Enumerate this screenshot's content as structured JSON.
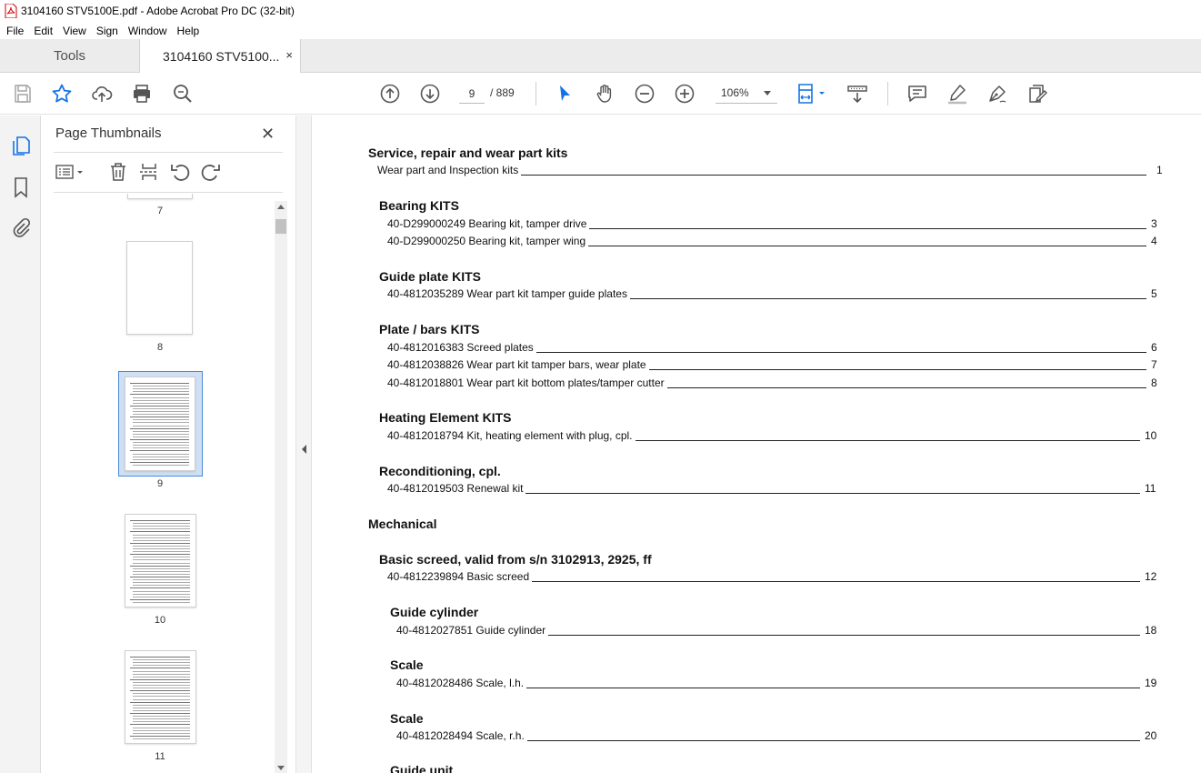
{
  "window": {
    "title": "3104160 STV5100E.pdf - Adobe Acrobat Pro DC (32-bit)"
  },
  "menu": [
    "File",
    "Edit",
    "View",
    "Sign",
    "Window",
    "Help"
  ],
  "tabs": {
    "tools": "Tools",
    "document": "3104160 STV5100...",
    "close": "×"
  },
  "toolbar": {
    "page_current": "9",
    "page_total": "/ 889",
    "zoom": "106%"
  },
  "thumbnails": {
    "title": "Page Thumbnails",
    "close": "✕",
    "pages": [
      {
        "label": "7"
      },
      {
        "label": "8"
      },
      {
        "label": "9",
        "selected": true
      },
      {
        "label": "10"
      },
      {
        "label": "11"
      }
    ]
  },
  "toc": {
    "sections": [
      {
        "heading": "Service, repair and wear part kits"
      },
      {
        "entry": "Wear part and Inspection kits",
        "page": "1"
      },
      {
        "heading": "Bearing KITS"
      },
      {
        "entry": "40-D299000249 Bearing kit, tamper drive",
        "page": "3"
      },
      {
        "entry": "40-D299000250 Bearing kit, tamper wing",
        "page": "4"
      },
      {
        "heading": "Guide plate KITS"
      },
      {
        "entry": "40-4812035289 Wear part kit tamper guide plates",
        "page": "5"
      },
      {
        "heading": "Plate / bars KITS"
      },
      {
        "entry": "40-4812016383 Screed plates",
        "page": "6"
      },
      {
        "entry": "40-4812038826 Wear part kit tamper bars, wear plate",
        "page": "7"
      },
      {
        "entry": "40-4812018801 Wear part kit bottom plates/tamper cutter",
        "page": "8"
      },
      {
        "heading": "Heating Element KITS"
      },
      {
        "entry": "40-4812018794 Kit, heating element with plug, cpl.",
        "page": "10"
      },
      {
        "heading": "Reconditioning, cpl."
      },
      {
        "entry": "40-4812019503 Renewal kit",
        "page": "11"
      },
      {
        "heading": "Mechanical"
      },
      {
        "heading": "Basic screed, valid from s/n 3102913, 2925, ff"
      },
      {
        "entry": "40-4812239894 Basic screed",
        "page": "12"
      },
      {
        "heading": "Guide cylinder"
      },
      {
        "entry": "40-4812027851 Guide cylinder",
        "page": "18"
      },
      {
        "heading": "Scale"
      },
      {
        "entry": "40-4812028486 Scale, l.h.",
        "page": "19"
      },
      {
        "heading": "Scale"
      },
      {
        "entry": "40-4812028494 Scale, r.h.",
        "page": "20"
      },
      {
        "heading": "Guide unit"
      }
    ]
  }
}
